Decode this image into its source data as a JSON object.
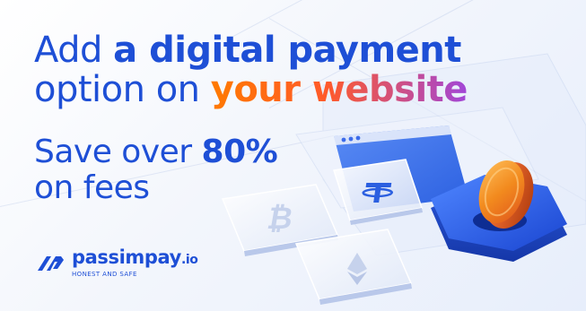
{
  "headline": {
    "line1_regular": "Add ",
    "line1_bold": "a digital payment",
    "line2_regular": "option on ",
    "line2_gradient": "your website"
  },
  "subhead": {
    "line1_regular": "Save over ",
    "line1_bold": "80%",
    "line2": "on fees"
  },
  "logo": {
    "name": "passimpay",
    "tld": ".io",
    "tagline": "HONEST AND SAFE"
  },
  "colors": {
    "brand_blue": "#1e4fd6",
    "accent_orange": "#ff7a00",
    "accent_purple": "#a146d8",
    "coin_orange": "#f08a24"
  },
  "icons": [
    "bitcoin-icon",
    "tether-icon",
    "ethereum-icon",
    "coin-icon",
    "wallet-slot-icon"
  ]
}
